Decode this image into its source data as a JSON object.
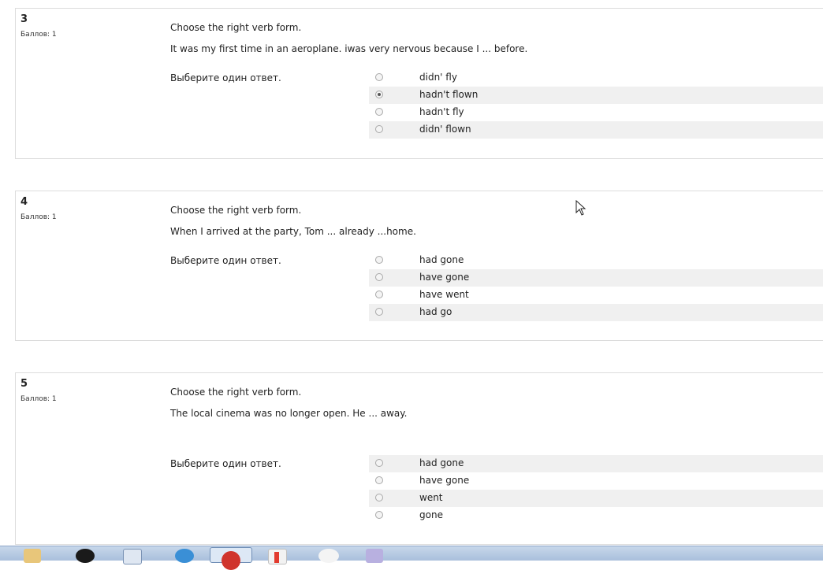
{
  "questions": [
    {
      "number": "3",
      "grade": "Баллов: 1",
      "prompt_line1": "Choose the right verb form.",
      "prompt_line2": "It was my first time in an aeroplane. iwas very nervous because I ... before.",
      "instruction": "Выберите один ответ.",
      "options": [
        {
          "label": "didn' fly",
          "checked": false
        },
        {
          "label": "hadn't flown",
          "checked": true
        },
        {
          "label": "hadn't fly",
          "checked": false
        },
        {
          "label": "didn' flown",
          "checked": false
        }
      ]
    },
    {
      "number": "4",
      "grade": "Баллов: 1",
      "prompt_line1": "Choose the right verb form.",
      "prompt_line2": "When I arrived at the party, Tom ... already ...home.",
      "instruction": "Выберите один ответ.",
      "options": [
        {
          "label": "had gone",
          "checked": false
        },
        {
          "label": "have gone",
          "checked": false
        },
        {
          "label": "have went",
          "checked": false
        },
        {
          "label": "had go",
          "checked": false
        }
      ]
    },
    {
      "number": "5",
      "grade": "Баллов: 1",
      "prompt_line1": "Choose the right verb form.",
      "prompt_line2": "The local cinema was no longer open. He ... away.",
      "instruction": "Выберите один ответ.",
      "options": [
        {
          "label": "had gone",
          "checked": false
        },
        {
          "label": "have gone",
          "checked": false
        },
        {
          "label": "went",
          "checked": false
        },
        {
          "label": "gone",
          "checked": false
        }
      ]
    }
  ],
  "taskbar": {
    "icons": [
      "file-manager-icon",
      "media-player-icon",
      "document-icon",
      "internet-explorer-icon",
      "browser-active-icon",
      "office-icon",
      "messenger-icon",
      "mail-icon"
    ]
  }
}
